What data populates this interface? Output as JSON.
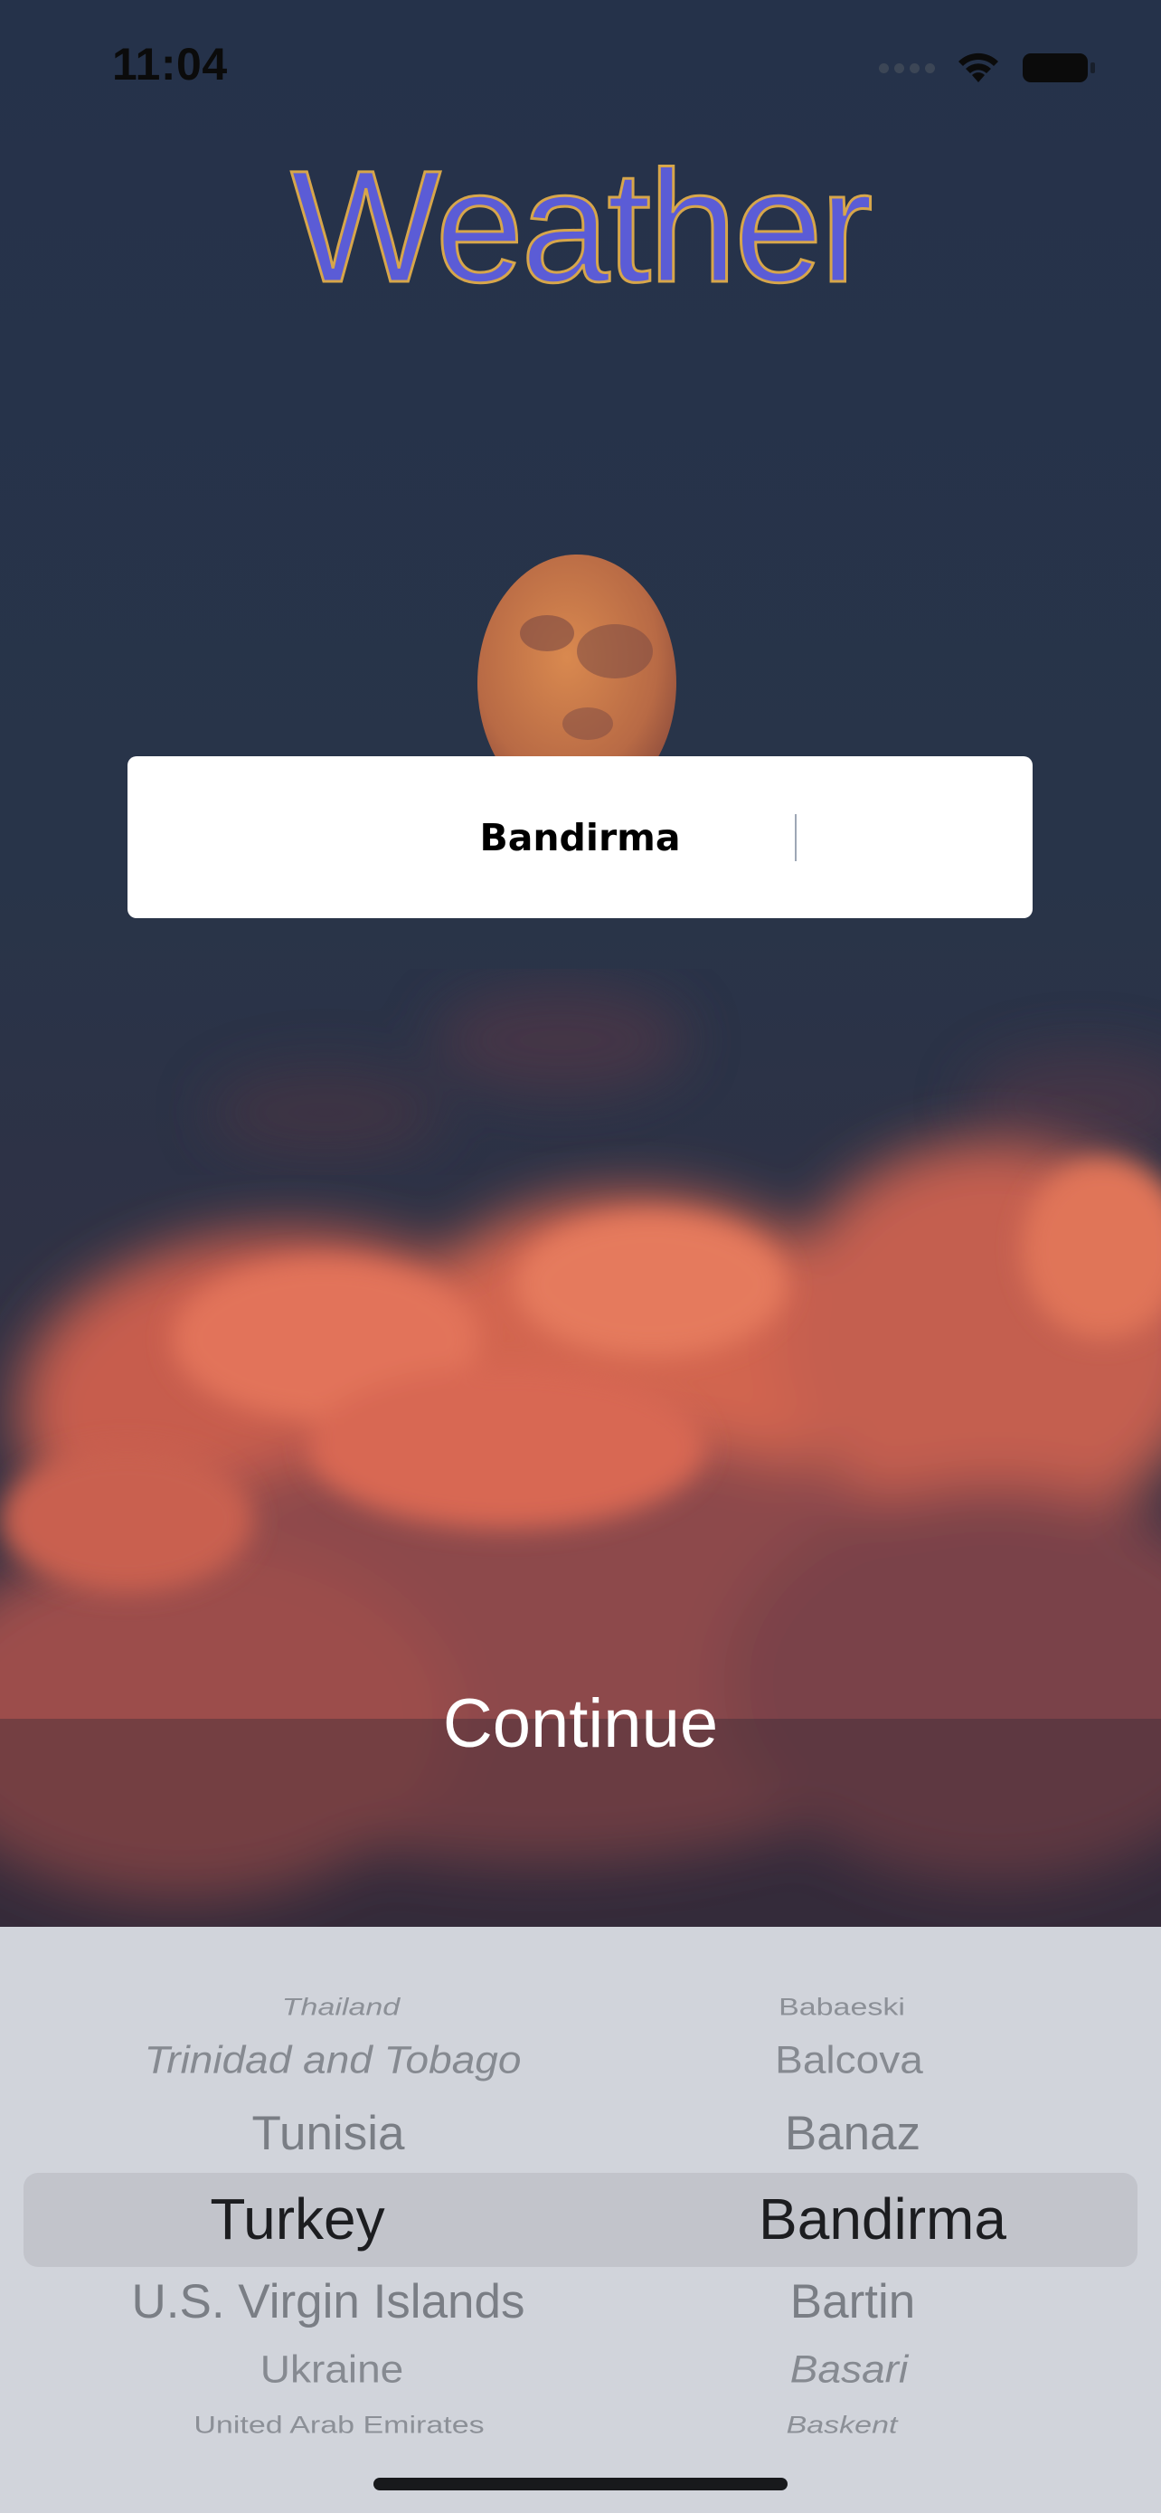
{
  "status_bar": {
    "time": "11:04"
  },
  "app": {
    "title": "Weather"
  },
  "search": {
    "value": "Bandirma"
  },
  "actions": {
    "continue_label": "Continue"
  },
  "picker": {
    "countries": [
      "Thailand",
      "Trinidad and Tobago",
      "Tunisia",
      "Turkey",
      "U.S. Virgin Islands",
      "Ukraine",
      "United Arab Emirates"
    ],
    "selected_country": "Turkey",
    "cities": [
      "Babaeski",
      "Balcova",
      "Banaz",
      "Bandirma",
      "Bartin",
      "Basari",
      "Baskent"
    ],
    "selected_city": "Bandirma"
  },
  "colors": {
    "title": "#5b5cd6",
    "title_outline": "#d7a64a",
    "sky": "#273548",
    "clouds": "#e2735a",
    "moon": "#c9744c",
    "picker_background": "#d1d4db"
  }
}
